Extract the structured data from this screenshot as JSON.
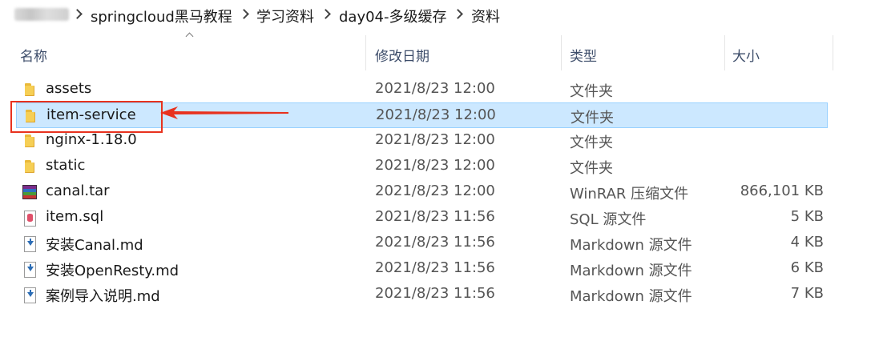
{
  "breadcrumb": {
    "items": [
      "springcloud黑马教程",
      "学习资料",
      "day04-多级缓存",
      "资料"
    ]
  },
  "columns": {
    "name": "名称",
    "date": "修改日期",
    "type": "类型",
    "size": "大小"
  },
  "files": [
    {
      "name": "assets",
      "date": "2021/8/23 12:00",
      "type": "文件夹",
      "size": "",
      "icon": "folder-icon"
    },
    {
      "name": "item-service",
      "date": "2021/8/23 12:00",
      "type": "文件夹",
      "size": "",
      "icon": "folder-icon",
      "selected": true
    },
    {
      "name": "nginx-1.18.0",
      "date": "2021/8/23 12:00",
      "type": "文件夹",
      "size": "",
      "icon": "folder-icon"
    },
    {
      "name": "static",
      "date": "2021/8/23 12:00",
      "type": "文件夹",
      "size": "",
      "icon": "folder-icon"
    },
    {
      "name": "canal.tar",
      "date": "2021/8/23 12:00",
      "type": "WinRAR 压缩文件",
      "size": "866,101 KB",
      "icon": "winrar-archive-icon"
    },
    {
      "name": "item.sql",
      "date": "2021/8/23 11:56",
      "type": "SQL 源文件",
      "size": "5 KB",
      "icon": "sql-file-icon"
    },
    {
      "name": "安装Canal.md",
      "date": "2021/8/23 11:56",
      "type": "Markdown 源文件",
      "size": "4 KB",
      "icon": "markdown-file-icon"
    },
    {
      "name": "安装OpenResty.md",
      "date": "2021/8/23 11:56",
      "type": "Markdown 源文件",
      "size": "6 KB",
      "icon": "markdown-file-icon"
    },
    {
      "name": "案例导入说明.md",
      "date": "2021/8/23 11:56",
      "type": "Markdown 源文件",
      "size": "7 KB",
      "icon": "markdown-file-icon"
    }
  ],
  "colors": {
    "selection_bg": "#cce8ff",
    "selection_border": "#99d1ff",
    "annotation": "#e8321e"
  }
}
